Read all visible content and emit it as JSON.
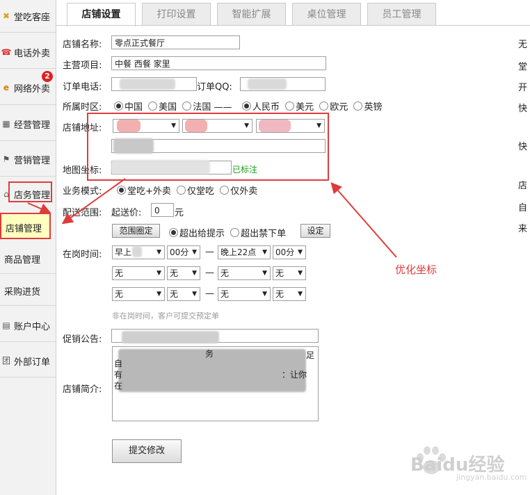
{
  "sidebar": {
    "items": [
      {
        "label": "堂吃客座",
        "icon": "plate-icon"
      },
      {
        "label": "电话外卖",
        "icon": "phone-icon"
      },
      {
        "label": "网络外卖",
        "icon": "ie-icon",
        "badge": "2"
      },
      {
        "label": "经营管理",
        "icon": "calendar-icon"
      },
      {
        "label": "营销管理",
        "icon": "flag-icon"
      },
      {
        "label": "店务管理",
        "icon": "house-icon"
      },
      {
        "label": "店铺管理"
      },
      {
        "label": "商品管理"
      },
      {
        "label": "采购进货"
      },
      {
        "label": "账户中心",
        "icon": "card-icon"
      },
      {
        "label": "外部订单",
        "icon": "group-icon"
      }
    ]
  },
  "tabs": [
    "店铺设置",
    "打印设置",
    "智能扩展",
    "桌位管理",
    "员工管理"
  ],
  "form": {
    "shop_name_label": "店铺名称:",
    "shop_name": "零点正式餐厅",
    "business_label": "主营项目:",
    "business": "中餐 西餐 家里",
    "phone_label": "订单电话:",
    "qq_label": "订单QQ:",
    "timezone_label": "所属时区:",
    "tz_options": [
      "中国",
      "美国",
      "法国 ——"
    ],
    "currency_options": [
      "人民币",
      "美元",
      "欧元",
      "英镑"
    ],
    "address_label": "店铺地址:",
    "map_label": "地图坐标:",
    "map_status": "已标注",
    "mode_label": "业务模式:",
    "mode_options": [
      "堂吃+外卖",
      "仅堂吃",
      "仅外卖"
    ],
    "delivery_label": "配送范围:",
    "min_price_label": "起送价:",
    "min_price": "0",
    "min_price_unit": "元",
    "range_button": "范围圈定",
    "over_options": [
      "超出给提示",
      "超出禁下单"
    ],
    "set_button": "设定",
    "hours_label": "在岗时间:",
    "hours_rows": [
      [
        "早上",
        "00分",
        "晚上22点",
        "00分"
      ],
      [
        "无",
        "无",
        "无",
        "无"
      ],
      [
        "无",
        "无",
        "无",
        "无"
      ]
    ],
    "dash": "—",
    "hours_hint": "非在岗时间，客户可提交预定单",
    "promo_label": "促销公告:",
    "intro_label": "店铺简介:",
    "intro_fragments": [
      "务",
      "足",
      "自",
      "：让你",
      "有",
      "在"
    ],
    "submit_button": "提交修改"
  },
  "right_column": [
    "无",
    "堂",
    "开",
    "快",
    "快",
    "店",
    "自",
    "来"
  ],
  "annotation": {
    "text": "优化坐标",
    "color": "#e03b3b"
  },
  "watermark": {
    "brand": "Baidu经验",
    "url": "jingyan.baidu.com"
  }
}
